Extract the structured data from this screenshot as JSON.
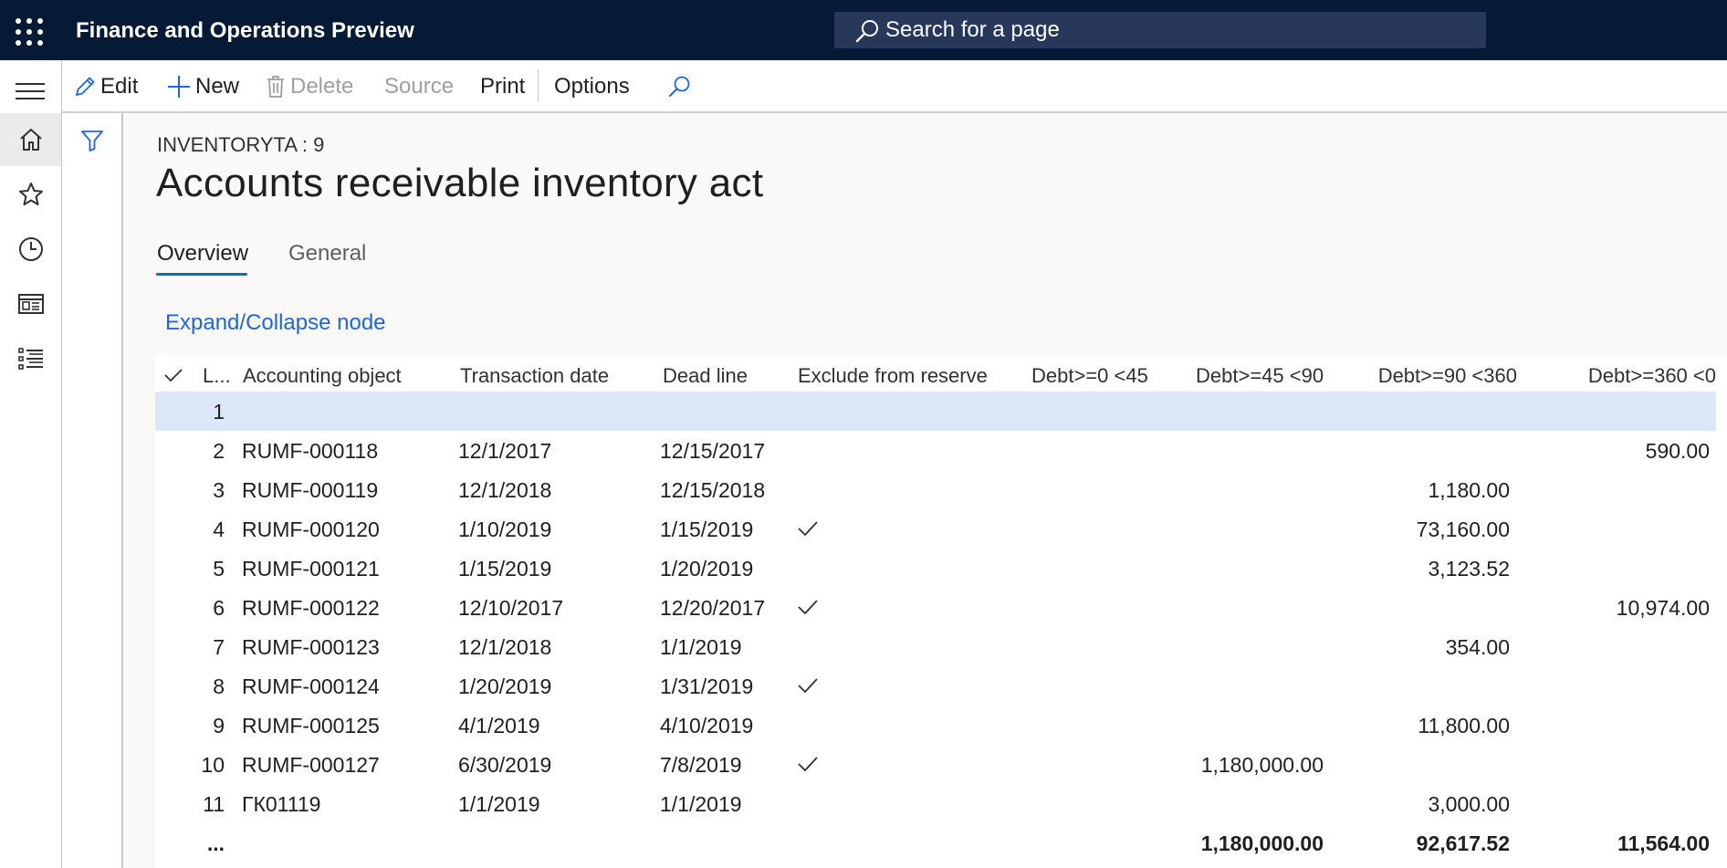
{
  "app": {
    "title": "Finance and Operations Preview"
  },
  "search": {
    "placeholder": "Search for a page"
  },
  "actions": {
    "edit": "Edit",
    "new": "New",
    "delete": "Delete",
    "source": "Source",
    "print": "Print",
    "options": "Options"
  },
  "page": {
    "caption": "INVENTORYTA : 9",
    "title": "Accounts receivable inventory act"
  },
  "tabs": [
    {
      "label": "Overview",
      "active": true
    },
    {
      "label": "General",
      "active": false
    }
  ],
  "link": {
    "expand_collapse": "Expand/Collapse node"
  },
  "grid": {
    "headers": {
      "line": "L...",
      "accounting_object": "Accounting object",
      "transaction_date": "Transaction date",
      "dead_line": "Dead line",
      "exclude": "Exclude from reserve",
      "debt_0_45": "Debt>=0 <45",
      "debt_45_90": "Debt>=45 <90",
      "debt_90_360": "Debt>=90 <360",
      "debt_360": "Debt>=360 <0"
    },
    "rows": [
      {
        "line": "1",
        "object": "",
        "tdate": "",
        "deadline": "",
        "exclude": false,
        "d45_90": "",
        "d90_360": "",
        "d360": ""
      },
      {
        "line": "2",
        "object": "RUMF-000118",
        "tdate": "12/1/2017",
        "deadline": "12/15/2017",
        "exclude": false,
        "d45_90": "",
        "d90_360": "",
        "d360": "590.00"
      },
      {
        "line": "3",
        "object": "RUMF-000119",
        "tdate": "12/1/2018",
        "deadline": "12/15/2018",
        "exclude": false,
        "d45_90": "",
        "d90_360": "1,180.00",
        "d360": ""
      },
      {
        "line": "4",
        "object": "RUMF-000120",
        "tdate": "1/10/2019",
        "deadline": "1/15/2019",
        "exclude": true,
        "d45_90": "",
        "d90_360": "73,160.00",
        "d360": ""
      },
      {
        "line": "5",
        "object": "RUMF-000121",
        "tdate": "1/15/2019",
        "deadline": "1/20/2019",
        "exclude": false,
        "d45_90": "",
        "d90_360": "3,123.52",
        "d360": ""
      },
      {
        "line": "6",
        "object": "RUMF-000122",
        "tdate": "12/10/2017",
        "deadline": "12/20/2017",
        "exclude": true,
        "d45_90": "",
        "d90_360": "",
        "d360": "10,974.00"
      },
      {
        "line": "7",
        "object": "RUMF-000123",
        "tdate": "12/1/2018",
        "deadline": "1/1/2019",
        "exclude": false,
        "d45_90": "",
        "d90_360": "354.00",
        "d360": ""
      },
      {
        "line": "8",
        "object": "RUMF-000124",
        "tdate": "1/20/2019",
        "deadline": "1/31/2019",
        "exclude": true,
        "d45_90": "",
        "d90_360": "",
        "d360": ""
      },
      {
        "line": "9",
        "object": "RUMF-000125",
        "tdate": "4/1/2019",
        "deadline": "4/10/2019",
        "exclude": false,
        "d45_90": "",
        "d90_360": "11,800.00",
        "d360": ""
      },
      {
        "line": "10",
        "object": "RUMF-000127",
        "tdate": "6/30/2019",
        "deadline": "7/8/2019",
        "exclude": true,
        "d45_90": "1,180,000.00",
        "d90_360": "",
        "d360": ""
      },
      {
        "line": "11",
        "object": "ГК01119",
        "tdate": "1/1/2019",
        "deadline": "1/1/2019",
        "exclude": false,
        "d45_90": "",
        "d90_360": "3,000.00",
        "d360": ""
      }
    ],
    "totals": {
      "label": "...",
      "d45_90": "1,180,000.00",
      "d90_360": "92,617.52",
      "d360": "11,564.00"
    }
  },
  "icons": {
    "waffle": "app-launcher-icon",
    "hamburger": "hamburger-menu-icon",
    "home": "home-icon",
    "favorites": "star-icon",
    "recent": "clock-icon",
    "workspaces": "workspace-icon",
    "modules": "modules-list-icon",
    "filter": "filter-icon",
    "search": "search-icon"
  },
  "colors": {
    "topbar": "#041a35",
    "search_box": "#27385b",
    "accent": "#0f6cbd",
    "link": "#2266d1",
    "selected_row": "#dde7fa"
  }
}
